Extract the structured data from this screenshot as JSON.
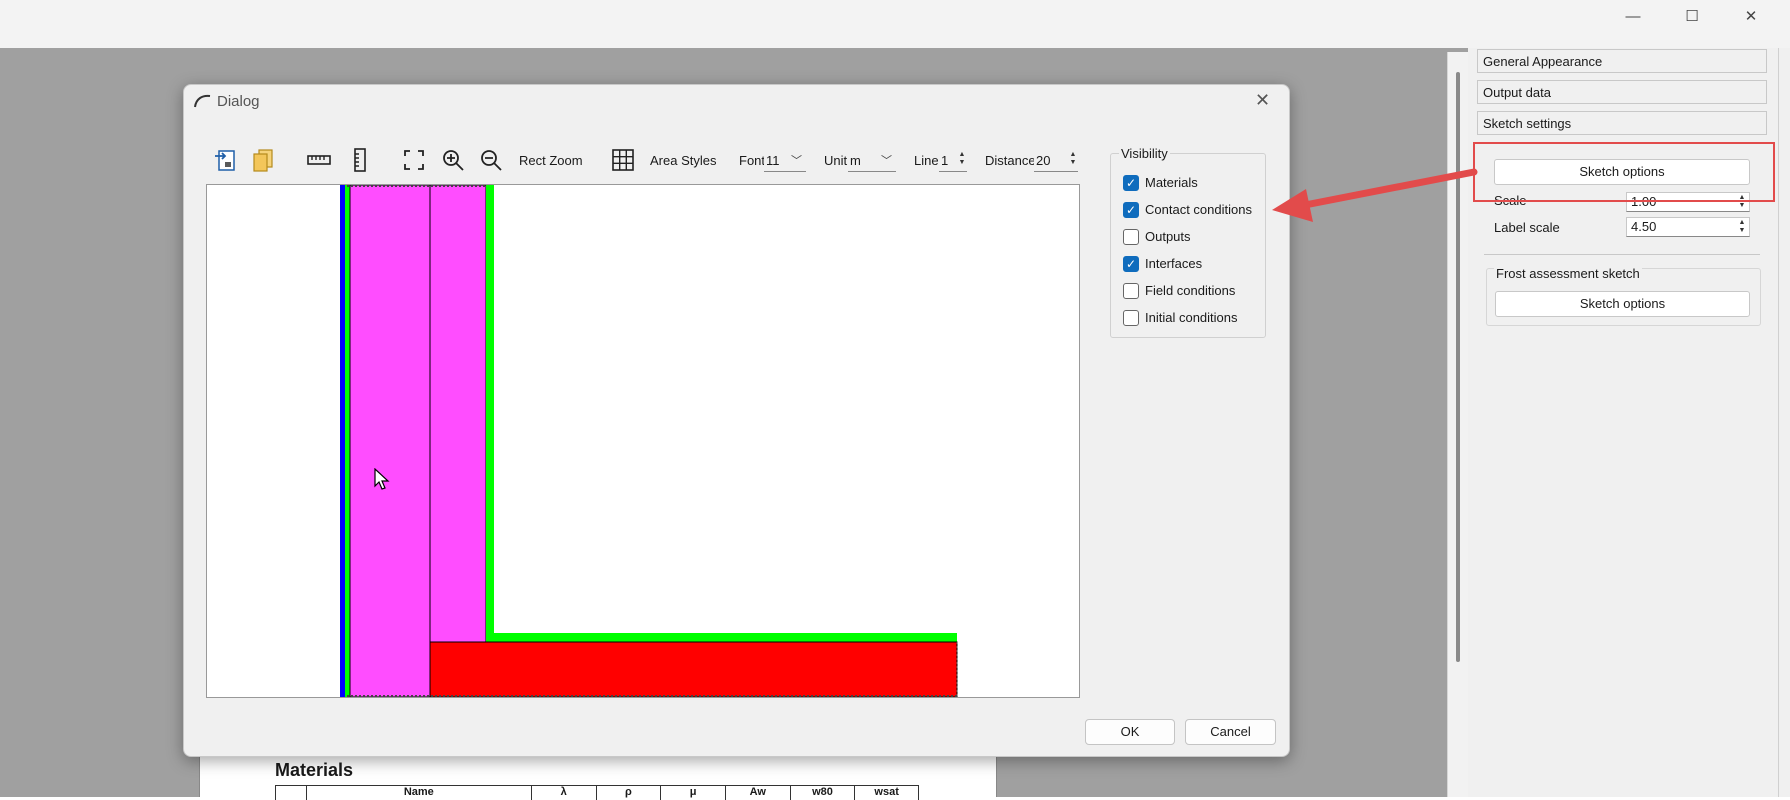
{
  "window": {
    "minimize_glyph": "—",
    "maximize_glyph": "☐",
    "close_glyph": "✕"
  },
  "right_panel": {
    "accordion": [
      "General Appearance",
      "Output data",
      "Sketch settings"
    ],
    "sketch_options_label": "Sketch options",
    "scale_label": "Scale",
    "scale_value": "1.00",
    "label_scale_label": "Label scale",
    "label_scale_value": "4.50",
    "frost_group_title": "Frost assessment sketch",
    "frost_sketch_options_label": "Sketch options"
  },
  "report": {
    "section_title": "Materials",
    "table_headers": [
      "",
      "Name",
      "λ",
      "ρ",
      "μ",
      "Aw",
      "w80",
      "wsat"
    ]
  },
  "dialog": {
    "title": "Dialog",
    "close_glyph": "✕",
    "toolbar": {
      "rect_zoom_label": "Rect Zoom",
      "area_styles_label": "Area Styles",
      "font_label": "Font",
      "font_value": "11",
      "unit_label": "Unit",
      "unit_value": "m",
      "line_label": "Line",
      "line_value": "1",
      "distance_label": "Distance",
      "distance_value": "20"
    },
    "visibility": {
      "title": "Visibility",
      "items": [
        {
          "label": "Materials",
          "checked": true
        },
        {
          "label": "Contact conditions",
          "checked": true
        },
        {
          "label": "Outputs",
          "checked": false
        },
        {
          "label": "Interfaces",
          "checked": true
        },
        {
          "label": "Field conditions",
          "checked": false
        },
        {
          "label": "Initial conditions",
          "checked": false
        }
      ]
    },
    "ok_label": "OK",
    "cancel_label": "Cancel"
  },
  "colors": {
    "material_magenta": "#ff4dff",
    "material_red": "#ff0000",
    "contact_green": "#00ff00",
    "contact_blue": "#0000ff",
    "annotation_red": "#e24b4b",
    "checkbox_blue": "#0f6cbd"
  },
  "icons": [
    "import-icon",
    "copy-icon",
    "ruler-icon",
    "measure-icon",
    "fit-view-icon",
    "zoom-in-icon",
    "zoom-out-icon",
    "grid-icon",
    "dialog-app-icon",
    "mouse-cursor-icon",
    "annotation-arrow"
  ]
}
